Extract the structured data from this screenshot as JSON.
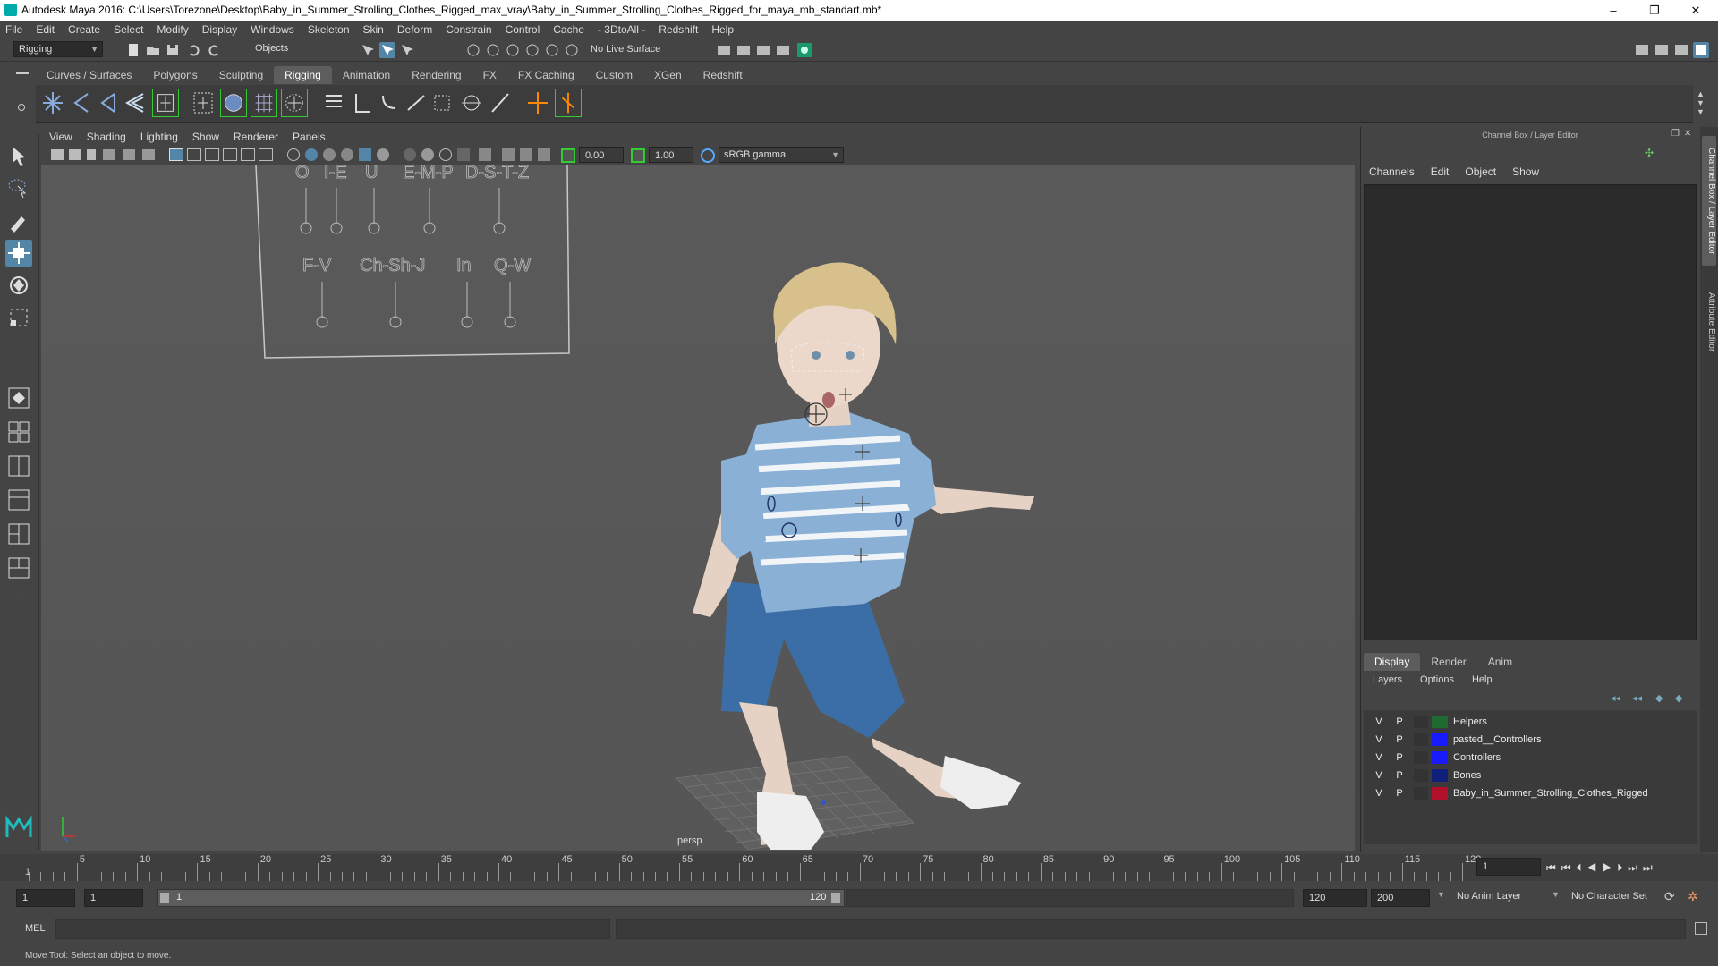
{
  "window": {
    "title": "Autodesk Maya 2016: C:\\Users\\Torezone\\Desktop\\Baby_in_Summer_Strolling_Clothes_Rigged_max_vray\\Baby_in_Summer_Strolling_Clothes_Rigged_for_maya_mb_standart.mb*",
    "controls": [
      "–",
      "❐",
      "✕"
    ]
  },
  "menubar": [
    "File",
    "Edit",
    "Create",
    "Select",
    "Modify",
    "Display",
    "Windows",
    "Skeleton",
    "Skin",
    "Deform",
    "Constrain",
    "Control",
    "Cache",
    "- 3DtoAll -",
    "Redshift",
    "Help"
  ],
  "toolbar": {
    "mode": "Rigging",
    "selection": "Objects",
    "live_surface": "No Live Surface"
  },
  "shelf_tabs": [
    "Curves / Surfaces",
    "Polygons",
    "Sculpting",
    "Rigging",
    "Animation",
    "Rendering",
    "FX",
    "FX Caching",
    "Custom",
    "XGen",
    "Redshift"
  ],
  "shelf_active": "Rigging",
  "viewport": {
    "menu": [
      "View",
      "Shading",
      "Lighting",
      "Show",
      "Renderer",
      "Panels"
    ],
    "exposure": "0.00",
    "gamma": "1.00",
    "color_space": "sRGB gamma",
    "camera": "persp",
    "face_rig_labels_row1": [
      "O",
      "I-E",
      "U",
      "E-M-P",
      "D-S-T-Z"
    ],
    "face_rig_labels_row2": [
      "F-V",
      "Ch-Sh-J",
      "In",
      "Q-W"
    ]
  },
  "right_panel": {
    "title": "Channel Box / Layer Editor",
    "menu": [
      "Channels",
      "Edit",
      "Object",
      "Show"
    ],
    "layer_tabs": [
      "Display",
      "Render",
      "Anim"
    ],
    "layer_tab_active": "Display",
    "layer_menu": [
      "Layers",
      "Options",
      "Help"
    ],
    "layers": [
      {
        "v": "V",
        "p": "P",
        "name": "Helpers",
        "color": "#1e6b32"
      },
      {
        "v": "V",
        "p": "P",
        "name": "pasted__Controllers",
        "color": "#1a1aff"
      },
      {
        "v": "V",
        "p": "P",
        "name": "Controllers",
        "color": "#1a1aff"
      },
      {
        "v": "V",
        "p": "P",
        "name": "Bones",
        "color": "#10207a"
      },
      {
        "v": "V",
        "p": "P",
        "name": "Baby_in_Summer_Strolling_Clothes_Rigged",
        "color": "#b0102a"
      }
    ],
    "side_tabs": [
      "Channel Box / Layer Editor",
      "Attribute Editor"
    ]
  },
  "timeline": {
    "ticks": [
      5,
      10,
      15,
      20,
      25,
      30,
      35,
      40,
      45,
      50,
      55,
      60,
      65,
      70,
      75,
      80,
      85,
      90,
      95,
      100,
      105,
      110,
      115,
      120
    ],
    "current_frame": "1",
    "start_label": "1"
  },
  "range": {
    "start": "1",
    "playback_start": "1",
    "slider_start": "1",
    "slider_end": "120",
    "playback_end": "120",
    "end": "200",
    "anim_layer": "No Anim Layer",
    "character_set": "No Character Set"
  },
  "command": {
    "lang": "MEL"
  },
  "help_line": "Move Tool: Select an object to move."
}
